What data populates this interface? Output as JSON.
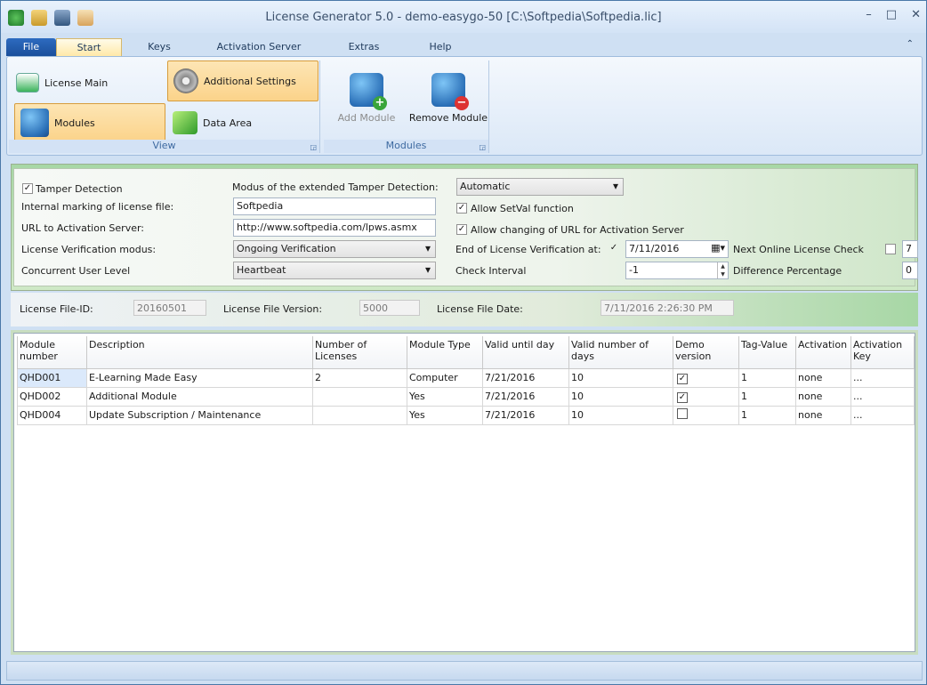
{
  "window": {
    "title": "License Generator 5.0  - demo-easygo-50 [C:\\Softpedia\\Softpedia.lic]",
    "min": "–",
    "max": "□",
    "close": "✕"
  },
  "tabs": [
    "File",
    "Start",
    "Keys",
    "Activation Server",
    "Extras",
    "Help"
  ],
  "ribbon": {
    "view_group": {
      "title": "View",
      "license_main": "License Main",
      "additional_settings": "Additional Settings",
      "modules": "Modules",
      "data_area": "Data Area"
    },
    "modules_group": {
      "title": "Modules",
      "add_module": "Add Module",
      "remove_module": "Remove Module"
    }
  },
  "form": {
    "tamper_detection": {
      "label": "Tamper Detection",
      "checked": true
    },
    "modus_extended_label": "Modus of the extended Tamper Detection:",
    "modus_extended_value": "Automatic",
    "internal_marking_label": "Internal marking of license file:",
    "internal_marking_value": "Softpedia",
    "allow_setval": {
      "label": "Allow SetVal function",
      "checked": true
    },
    "url_label": "URL to Activation Server:",
    "url_value": "http://www.softpedia.com/lpws.asmx",
    "allow_url_change": {
      "label": "Allow changing of URL for Activation Server",
      "checked": true
    },
    "verification_modus_label": "License Verification modus:",
    "verification_modus_value": "Ongoing Verification",
    "end_verification_label": "End of License Verification at:",
    "end_verification_checked": true,
    "end_verification_date": "7/11/2016",
    "next_online_label": "Next Online License Check",
    "next_online_value": "7",
    "concurrent_label": "Concurrent User Level",
    "concurrent_value": "Heartbeat",
    "check_interval_label": "Check Interval",
    "check_interval_value": "-1",
    "difference_label": "Difference Percentage",
    "difference_value": "0"
  },
  "info": {
    "file_id_label": "License File-ID:",
    "file_id_value": "20160501",
    "file_version_label": "License File Version:",
    "file_version_value": "5000",
    "file_date_label": "License File Date:",
    "file_date_value": "7/11/2016 2:26:30 PM"
  },
  "grid": {
    "columns": [
      "Module number",
      "Description",
      "Number of Licenses",
      "Module Type",
      "Valid until day",
      "Valid number of days",
      "Demo version",
      "Tag-Value",
      "Activation",
      "Activation Key"
    ],
    "rows": [
      {
        "number": "QHD001",
        "description": "E-Learning Made Easy",
        "licenses": "2",
        "type": "Computer",
        "valid_until": "7/21/2016",
        "valid_days": "10",
        "demo": true,
        "tag": "1",
        "activation": "none",
        "key": "..."
      },
      {
        "number": "QHD002",
        "description": "Additional Module",
        "licenses": "",
        "type": "Yes",
        "valid_until": "7/21/2016",
        "valid_days": "10",
        "demo": true,
        "tag": "1",
        "activation": "none",
        "key": "..."
      },
      {
        "number": "QHD004",
        "description": "Update Subscription / Maintenance",
        "licenses": "",
        "type": "Yes",
        "valid_until": "7/21/2016",
        "valid_days": "10",
        "demo": false,
        "tag": "1",
        "activation": "none",
        "key": "..."
      }
    ]
  },
  "colors": {
    "accent": "#1b4f9b",
    "active_button": "#fbd38a",
    "form_green": "#a7d7a5"
  }
}
